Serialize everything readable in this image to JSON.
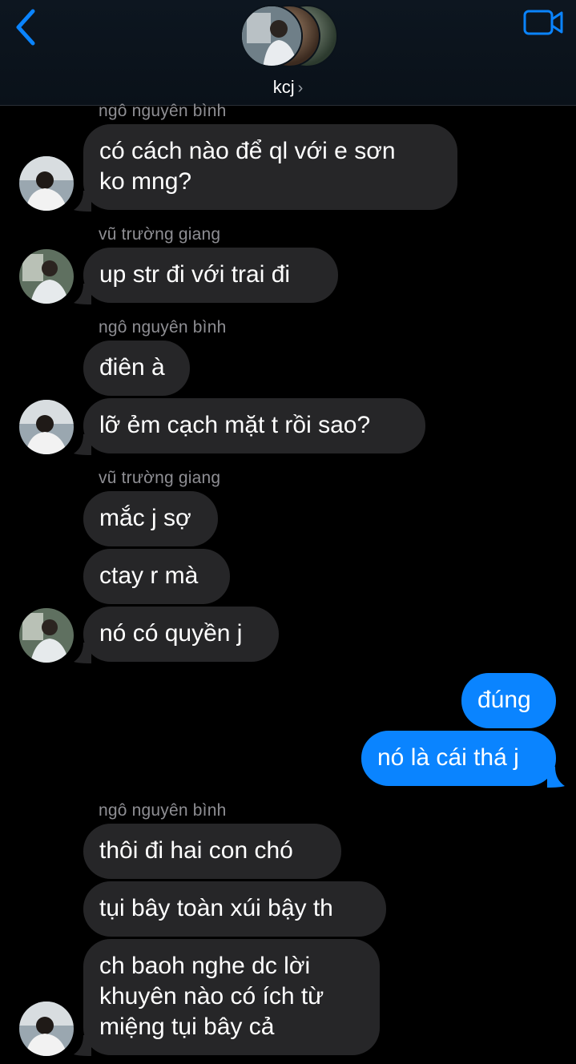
{
  "header": {
    "chat_name": "kcj",
    "name_chevron": "chevron-right-icon",
    "back_icon": "chevron-left-icon",
    "video_icon": "video-camera-icon",
    "accent": "#0a84ff"
  },
  "messages": {
    "s1": "ngô nguyên bình",
    "m1": "có cách nào để ql với e sơn\nko mng?",
    "s2": "vũ trường giang",
    "m2": "up str đi với trai đi",
    "s3": "ngô nguyên bình",
    "m3": "điên à",
    "m4": "lỡ ẻm cạch mặt t rồi sao?",
    "s4": "vũ trường giang",
    "m5": "mắc j sợ",
    "m6": "ctay r mà",
    "m7": "nó có quyền j",
    "o1": "đúng",
    "o2": "nó là cái thá j",
    "s5": "ngô nguyên bình",
    "m8": "thôi đi hai con chó",
    "m9": "tụi bây toàn xúi bậy th",
    "m10": "ch baoh nghe dc lời\nkhuyên nào có ích từ\nmiệng tụi bây cả"
  }
}
